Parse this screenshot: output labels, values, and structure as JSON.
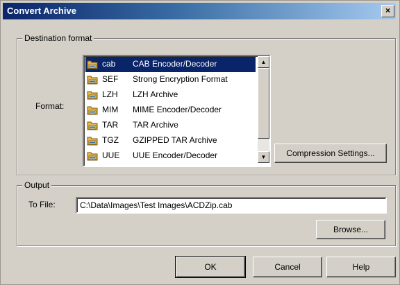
{
  "window": {
    "title": "Convert Archive",
    "close_label": "×"
  },
  "destination": {
    "legend": "Destination format",
    "format_label": "Format:",
    "formats": [
      {
        "ext": "cab",
        "desc": "CAB Encoder/Decoder",
        "selected": true,
        "icon": "archive-icon"
      },
      {
        "ext": "SEF",
        "desc": "Strong Encryption Format",
        "selected": false,
        "icon": "archive-icon"
      },
      {
        "ext": "LZH",
        "desc": "LZH Archive",
        "selected": false,
        "icon": "archive-icon"
      },
      {
        "ext": "MIM",
        "desc": "MIME Encoder/Decoder",
        "selected": false,
        "icon": "archive-icon"
      },
      {
        "ext": "TAR",
        "desc": "TAR Archive",
        "selected": false,
        "icon": "archive-icon"
      },
      {
        "ext": "TGZ",
        "desc": "GZIPPED TAR Archive",
        "selected": false,
        "icon": "archive-icon"
      },
      {
        "ext": "UUE",
        "desc": "UUE Encoder/Decoder",
        "selected": false,
        "icon": "archive-icon"
      }
    ],
    "compression_button": "Compression Settings..."
  },
  "output": {
    "legend": "Output",
    "to_file_label": "To File:",
    "to_file_value": "C:\\Data\\Images\\Test Images\\ACDZip.cab",
    "browse_button": "Browse..."
  },
  "footer": {
    "ok": "OK",
    "cancel": "Cancel",
    "help": "Help"
  },
  "colors": {
    "title_start": "#0a246a",
    "title_end": "#a6caf0",
    "face": "#d4d0c8",
    "selection": "#0a246a"
  }
}
